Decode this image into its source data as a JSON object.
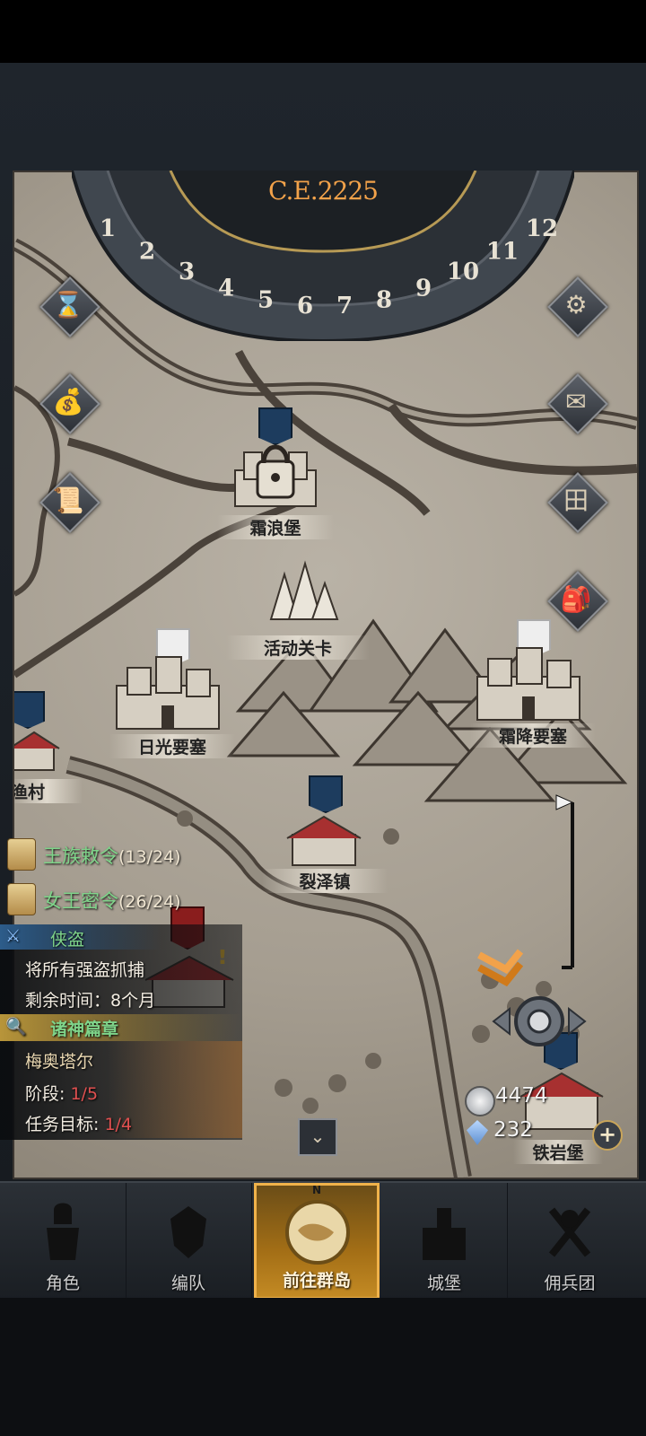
{
  "calendar": {
    "year": "C.E.2225",
    "months": [
      "1",
      "2",
      "3",
      "4",
      "5",
      "6",
      "7",
      "8",
      "9",
      "10",
      "11",
      "12"
    ]
  },
  "map": {
    "locations": {
      "frost_wave": "霜浪堡",
      "event_stage": "活动关卡",
      "sunlight_fortress": "日光要塞",
      "frostfall_fortress": "霜降要塞",
      "fishing_village": "渔村",
      "rift_town": "裂泽镇",
      "iron_rock": "铁岩堡"
    }
  },
  "quests": {
    "royal_decree": {
      "name": "王族敕令",
      "count": "(13/24)"
    },
    "queen_secret": {
      "name": "女王密令",
      "count": "(26/24)"
    },
    "thief": {
      "title": "侠盗",
      "desc": "将所有强盗抓捕",
      "time_label": "剩余时间：",
      "time_value": "8个月"
    },
    "gods": {
      "title": "诸神篇章",
      "hero": "梅奥塔尔",
      "stage_label": "阶段:",
      "stage_value": "1/5",
      "target_label": "任务目标:",
      "target_value": "1/4"
    }
  },
  "resources": {
    "silver": "4474",
    "crystal": "232"
  },
  "nav": {
    "items": [
      "角色",
      "编队",
      "前往群岛",
      "城堡",
      "佣兵团"
    ],
    "compass_n": "N"
  },
  "colors": {
    "accent": "#f2a24a",
    "quest_green": "#7fd48a",
    "nav_active": "#c38a24"
  },
  "icons": {
    "left": [
      "hourglass-icon",
      "money-bag-icon",
      "scroll-icon"
    ],
    "right": [
      "settings-icon",
      "mail-icon",
      "grid-icon",
      "bag-icon"
    ]
  }
}
